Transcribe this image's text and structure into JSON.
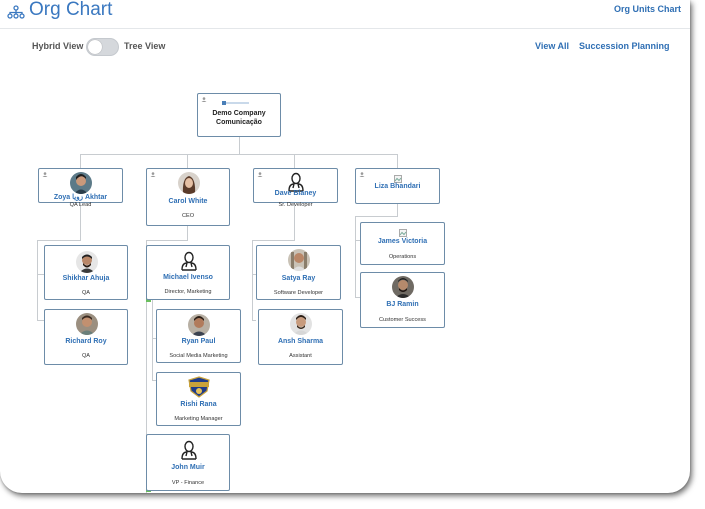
{
  "header": {
    "title": "Org Chart",
    "org_units_link": "Org Units Chart"
  },
  "toolbar": {
    "hybrid_label": "Hybrid View",
    "tree_label": "Tree View",
    "view_all": "View All",
    "succession": "Succession Planning",
    "tree_view_on": false
  },
  "colors": {
    "accent": "#2f6fb4",
    "card_border": "#6d8ca8",
    "connector": "#c8ccd0",
    "marker": "#6abf5e"
  },
  "root": {
    "name_line1": "Demo Company",
    "name_line2": "Comunicação"
  },
  "people": {
    "zoya": {
      "name": "Zoya زویا Akhtar",
      "role": "QA Lead"
    },
    "carol": {
      "name": "Carol White",
      "role": "CEO"
    },
    "dave": {
      "name": "Dave Blaney",
      "role": "Sr. Developer"
    },
    "liza": {
      "name": "Liza Bhandari",
      "role": ""
    },
    "shikhar": {
      "name": "Shikhar Ahuja",
      "role": "QA"
    },
    "richard": {
      "name": "Richard Roy",
      "role": "QA"
    },
    "michael": {
      "name": "Michael Ivenso",
      "role": "Director, Marketing"
    },
    "ryan": {
      "name": "Ryan Paul",
      "role": "Social Media Marketing"
    },
    "rishi": {
      "name": "Rishi Rana",
      "role": "Marketing Manager"
    },
    "john": {
      "name": "John Muir",
      "role": "VP - Finance"
    },
    "satya": {
      "name": "Satya Ray",
      "role": "Software Developer"
    },
    "ansh": {
      "name": "Ansh Sharma",
      "role": "Assistant"
    },
    "james": {
      "name": "James Victoria",
      "role": "Operations"
    },
    "bj": {
      "name": "BJ Ramin",
      "role": "Customer Success"
    }
  }
}
